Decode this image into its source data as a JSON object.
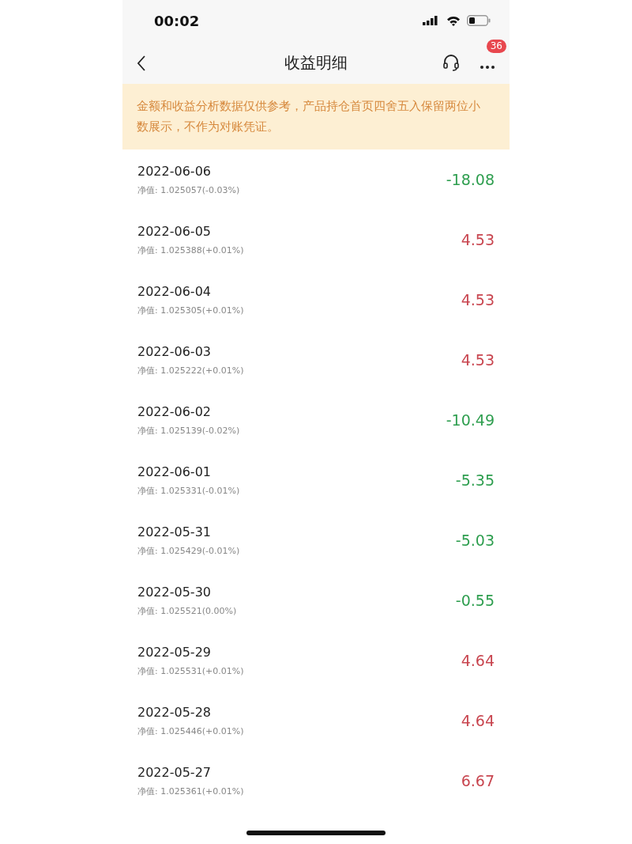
{
  "status_bar": {
    "time": "00:02"
  },
  "nav": {
    "title": "收益明细",
    "badge": "36"
  },
  "notice": "金额和收益分析数据仅供参考，产品持仓首页四舍五入保留两位小数展示，不作为对账凭证。",
  "rows": [
    {
      "date": "2022-06-06",
      "nav": "净值: 1.025057(-0.03%)",
      "amount": "-18.08",
      "color": "#2e9e4f"
    },
    {
      "date": "2022-06-05",
      "nav": "净值: 1.025388(+0.01%)",
      "amount": "4.53",
      "color": "#c8454f"
    },
    {
      "date": "2022-06-04",
      "nav": "净值: 1.025305(+0.01%)",
      "amount": "4.53",
      "color": "#c8454f"
    },
    {
      "date": "2022-06-03",
      "nav": "净值: 1.025222(+0.01%)",
      "amount": "4.53",
      "color": "#c8454f"
    },
    {
      "date": "2022-06-02",
      "nav": "净值: 1.025139(-0.02%)",
      "amount": "-10.49",
      "color": "#2e9e4f"
    },
    {
      "date": "2022-06-01",
      "nav": "净值: 1.025331(-0.01%)",
      "amount": "-5.35",
      "color": "#2e9e4f"
    },
    {
      "date": "2022-05-31",
      "nav": "净值: 1.025429(-0.01%)",
      "amount": "-5.03",
      "color": "#2e9e4f"
    },
    {
      "date": "2022-05-30",
      "nav": "净值: 1.025521(0.00%)",
      "amount": "-0.55",
      "color": "#2e9e4f"
    },
    {
      "date": "2022-05-29",
      "nav": "净值: 1.025531(+0.01%)",
      "amount": "4.64",
      "color": "#c8454f"
    },
    {
      "date": "2022-05-28",
      "nav": "净值: 1.025446(+0.01%)",
      "amount": "4.64",
      "color": "#c8454f"
    },
    {
      "date": "2022-05-27",
      "nav": "净值: 1.025361(+0.01%)",
      "amount": "6.67",
      "color": "#c8454f"
    }
  ]
}
